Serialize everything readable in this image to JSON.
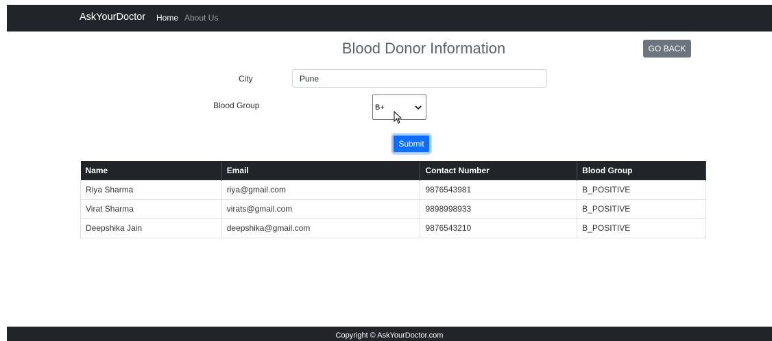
{
  "navbar": {
    "brand": "AskYourDoctor",
    "links": [
      {
        "label": "Home"
      },
      {
        "label": "About Us"
      }
    ]
  },
  "page": {
    "title": "Blood Donor Information",
    "go_back_label": "GO BACK"
  },
  "form": {
    "city_label": "City",
    "city_value": "Pune",
    "blood_group_label": "Blood Group",
    "blood_group_selected": "B+",
    "submit_label": "Submit"
  },
  "table": {
    "headers": [
      "Name",
      "Email",
      "Contact Number",
      "Blood Group"
    ],
    "rows": [
      [
        "Riya Sharma",
        "riya@gmail.com",
        "9876543981",
        "B_POSITIVE"
      ],
      [
        "Virat Sharma",
        "virats@gmail.com",
        "9898998933",
        "B_POSITIVE"
      ],
      [
        "Deepshika Jain",
        "deepshika@gmail.com",
        "9876543210",
        "B_POSITIVE"
      ]
    ]
  },
  "footer": {
    "text": "Copyright © AskYourDoctor.com"
  },
  "colors": {
    "navbar": "#212529",
    "primary": "#0d6efd",
    "secondary": "#6c757d"
  },
  "icons": {
    "select_arrow": "chevron-down-icon",
    "cursor": "mouse-pointer-icon"
  }
}
